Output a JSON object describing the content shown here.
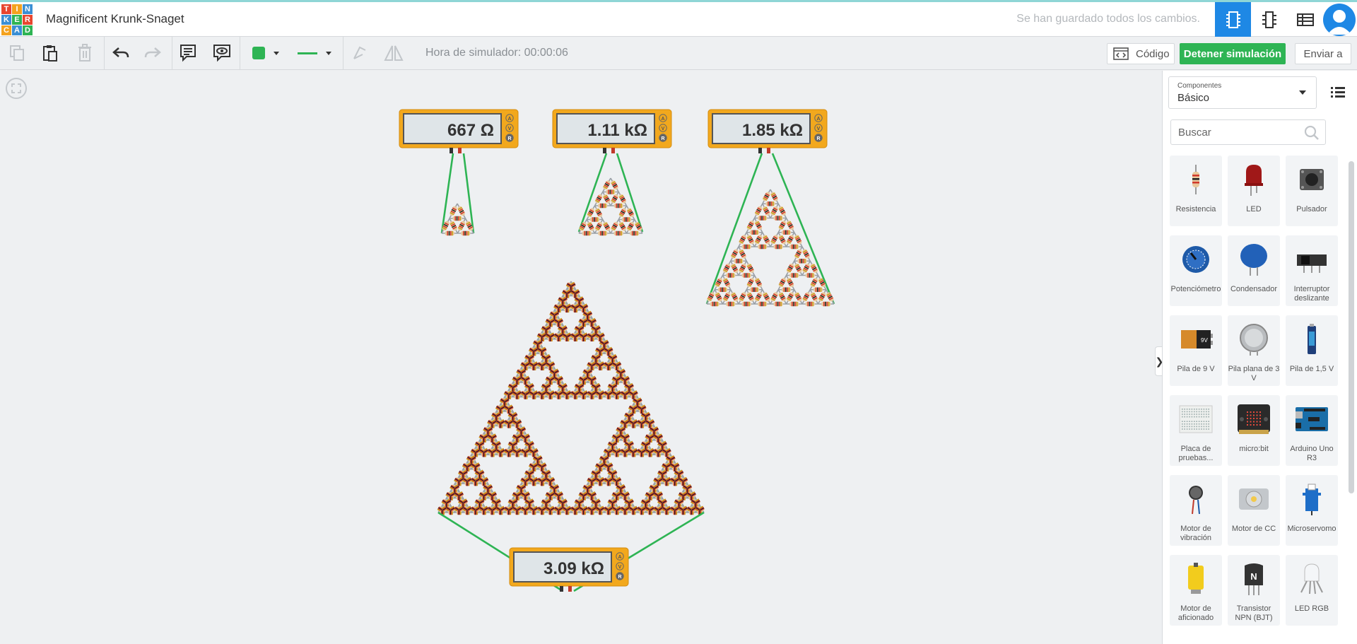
{
  "app": {
    "logo_letters": [
      "T",
      "I",
      "N",
      "K",
      "E",
      "R",
      "C",
      "A",
      "D"
    ],
    "logo_colors": [
      "#e8462f",
      "#f4a21e",
      "#3b8fd4",
      "#3b8fd4",
      "#2eb454",
      "#e8462f",
      "#f4a21e",
      "#3b8fd4",
      "#2eb454"
    ],
    "project_title": "Magnificent Krunk-Snaget",
    "save_status": "Se han guardado todos los cambios."
  },
  "toolbar": {
    "sim_time": "Hora de simulador: 00:00:06",
    "code_label": "Código",
    "stop_label": "Detener simulación",
    "send_label": "Enviar a",
    "fill_color": "#2eb454",
    "wire_color": "#2eb454"
  },
  "meters": [
    {
      "value": "667 Ω",
      "level": 1
    },
    {
      "value": "1.11 kΩ",
      "level": 2
    },
    {
      "value": "1.85 kΩ",
      "level": 3
    },
    {
      "value": "3.09 kΩ",
      "level": 4
    }
  ],
  "meter_mode_letters": [
    "A",
    "V",
    "R"
  ],
  "panel": {
    "select_label": "Componentes",
    "select_value": "Básico",
    "search_placeholder": "Buscar",
    "components": [
      {
        "name": "Resistencia",
        "icon": "resistor-icon"
      },
      {
        "name": "LED",
        "icon": "led-icon"
      },
      {
        "name": "Pulsador",
        "icon": "pushbutton-icon"
      },
      {
        "name": "Potenciómetro",
        "icon": "potentiometer-icon"
      },
      {
        "name": "Condensador",
        "icon": "capacitor-icon"
      },
      {
        "name": "Interruptor deslizante",
        "icon": "slide-switch-icon"
      },
      {
        "name": "Pila de 9 V",
        "icon": "battery-9v-icon"
      },
      {
        "name": "Pila plana de 3 V",
        "icon": "coin-cell-icon"
      },
      {
        "name": "Pila de 1,5 V",
        "icon": "battery-aa-icon"
      },
      {
        "name": "Placa de pruebas...",
        "icon": "breadboard-icon"
      },
      {
        "name": "micro:bit",
        "icon": "microbit-icon"
      },
      {
        "name": "Arduino Uno R3",
        "icon": "arduino-icon"
      },
      {
        "name": "Motor de vibración",
        "icon": "vibration-motor-icon"
      },
      {
        "name": "Motor de CC",
        "icon": "dc-motor-icon"
      },
      {
        "name": "Microservomo",
        "icon": "micro-servo-icon"
      },
      {
        "name": "Motor de aficionado",
        "icon": "hobby-motor-icon"
      },
      {
        "name": "Transistor NPN (BJT)",
        "icon": "npn-transistor-icon"
      },
      {
        "name": "LED RGB",
        "icon": "rgb-led-icon"
      }
    ],
    "transistor_letter": "N",
    "battery_label": "9V"
  }
}
